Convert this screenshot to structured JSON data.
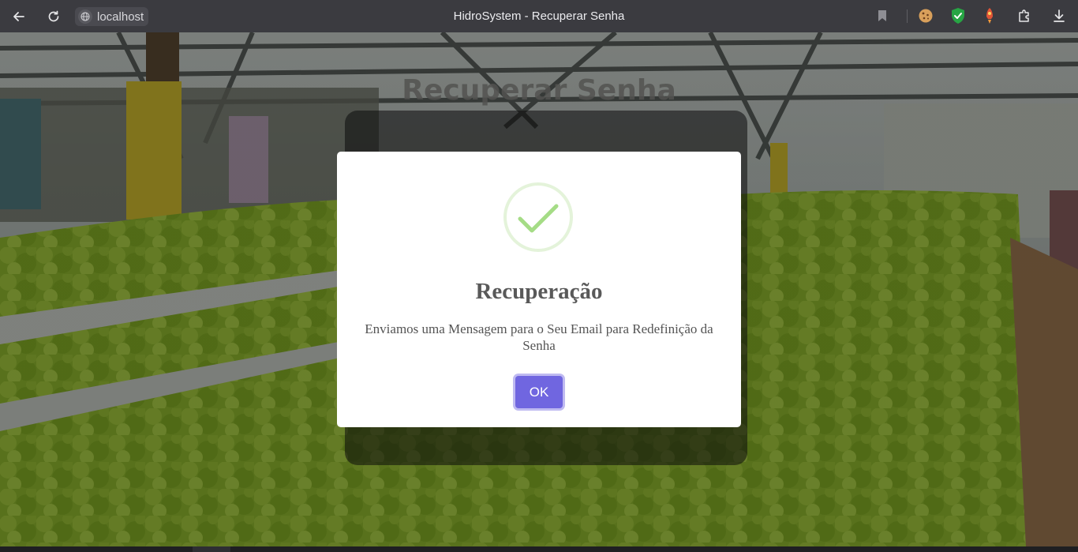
{
  "browser": {
    "url": "localhost",
    "tab_title": "HidroSystem - Recuperar Senha",
    "icons": {
      "back": "arrow-left-icon",
      "reload": "reload-icon",
      "site_info": "globe-icon",
      "bookmark": "bookmark-icon",
      "cookie_ext": "cookie-icon",
      "shield_ext": "shield-check-icon",
      "rocket_ext": "rocket-icon",
      "extensions": "puzzle-icon",
      "download": "download-icon"
    }
  },
  "page": {
    "heading": "Recuperar Senha"
  },
  "modal": {
    "title": "Recuperação",
    "message": "Enviamos uma Mensagem para o Seu Email para Redefinição da Senha",
    "confirm_label": "OK",
    "icon": "success-check-icon"
  },
  "colors": {
    "confirm_button": "#7066e0",
    "success_icon": "#a5dc86"
  }
}
